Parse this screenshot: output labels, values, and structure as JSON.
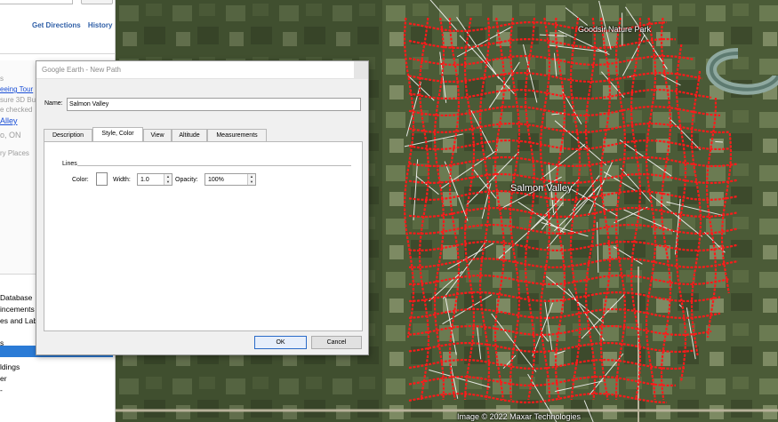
{
  "sidebar": {
    "links": {
      "directions": "Get Directions",
      "history": "History"
    },
    "places": {
      "frag_s": "s",
      "tour": "eeing Tour",
      "note1": "sure 3D Bu",
      "note2": "e checked",
      "salmon": "Alley",
      "location": "o, ON",
      "temp": "ry Places"
    },
    "layers": {
      "database": "Database",
      "announcements": "incements",
      "labels": "es and Labe",
      "highlighted": "s",
      "buildings": "ldings",
      "weather": "er",
      "more": "-"
    }
  },
  "map": {
    "labels": {
      "park": "Goodsir Nature Park",
      "valley": "Salmon Valley"
    },
    "attribution": "Image © 2022 Maxar Technologies",
    "path_color": "#ff1a1a",
    "path_outline_color": "#ffffff"
  },
  "dialog": {
    "title": "Google Earth - New Path",
    "name_label": "Name:",
    "name_value": "Salmon Valley",
    "tabs": [
      {
        "label": "Description"
      },
      {
        "label": "Style, Color"
      },
      {
        "label": "View"
      },
      {
        "label": "Altitude"
      },
      {
        "label": "Measurements"
      }
    ],
    "active_tab": "Style, Color",
    "lines_group": "Lines",
    "color_label": "Color:",
    "line_color": "#ffffff",
    "width_label": "Width:",
    "width_value": "1.0",
    "opacity_label": "Opacity:",
    "opacity_value": "100%",
    "ok_label": "OK",
    "cancel_label": "Cancel"
  }
}
